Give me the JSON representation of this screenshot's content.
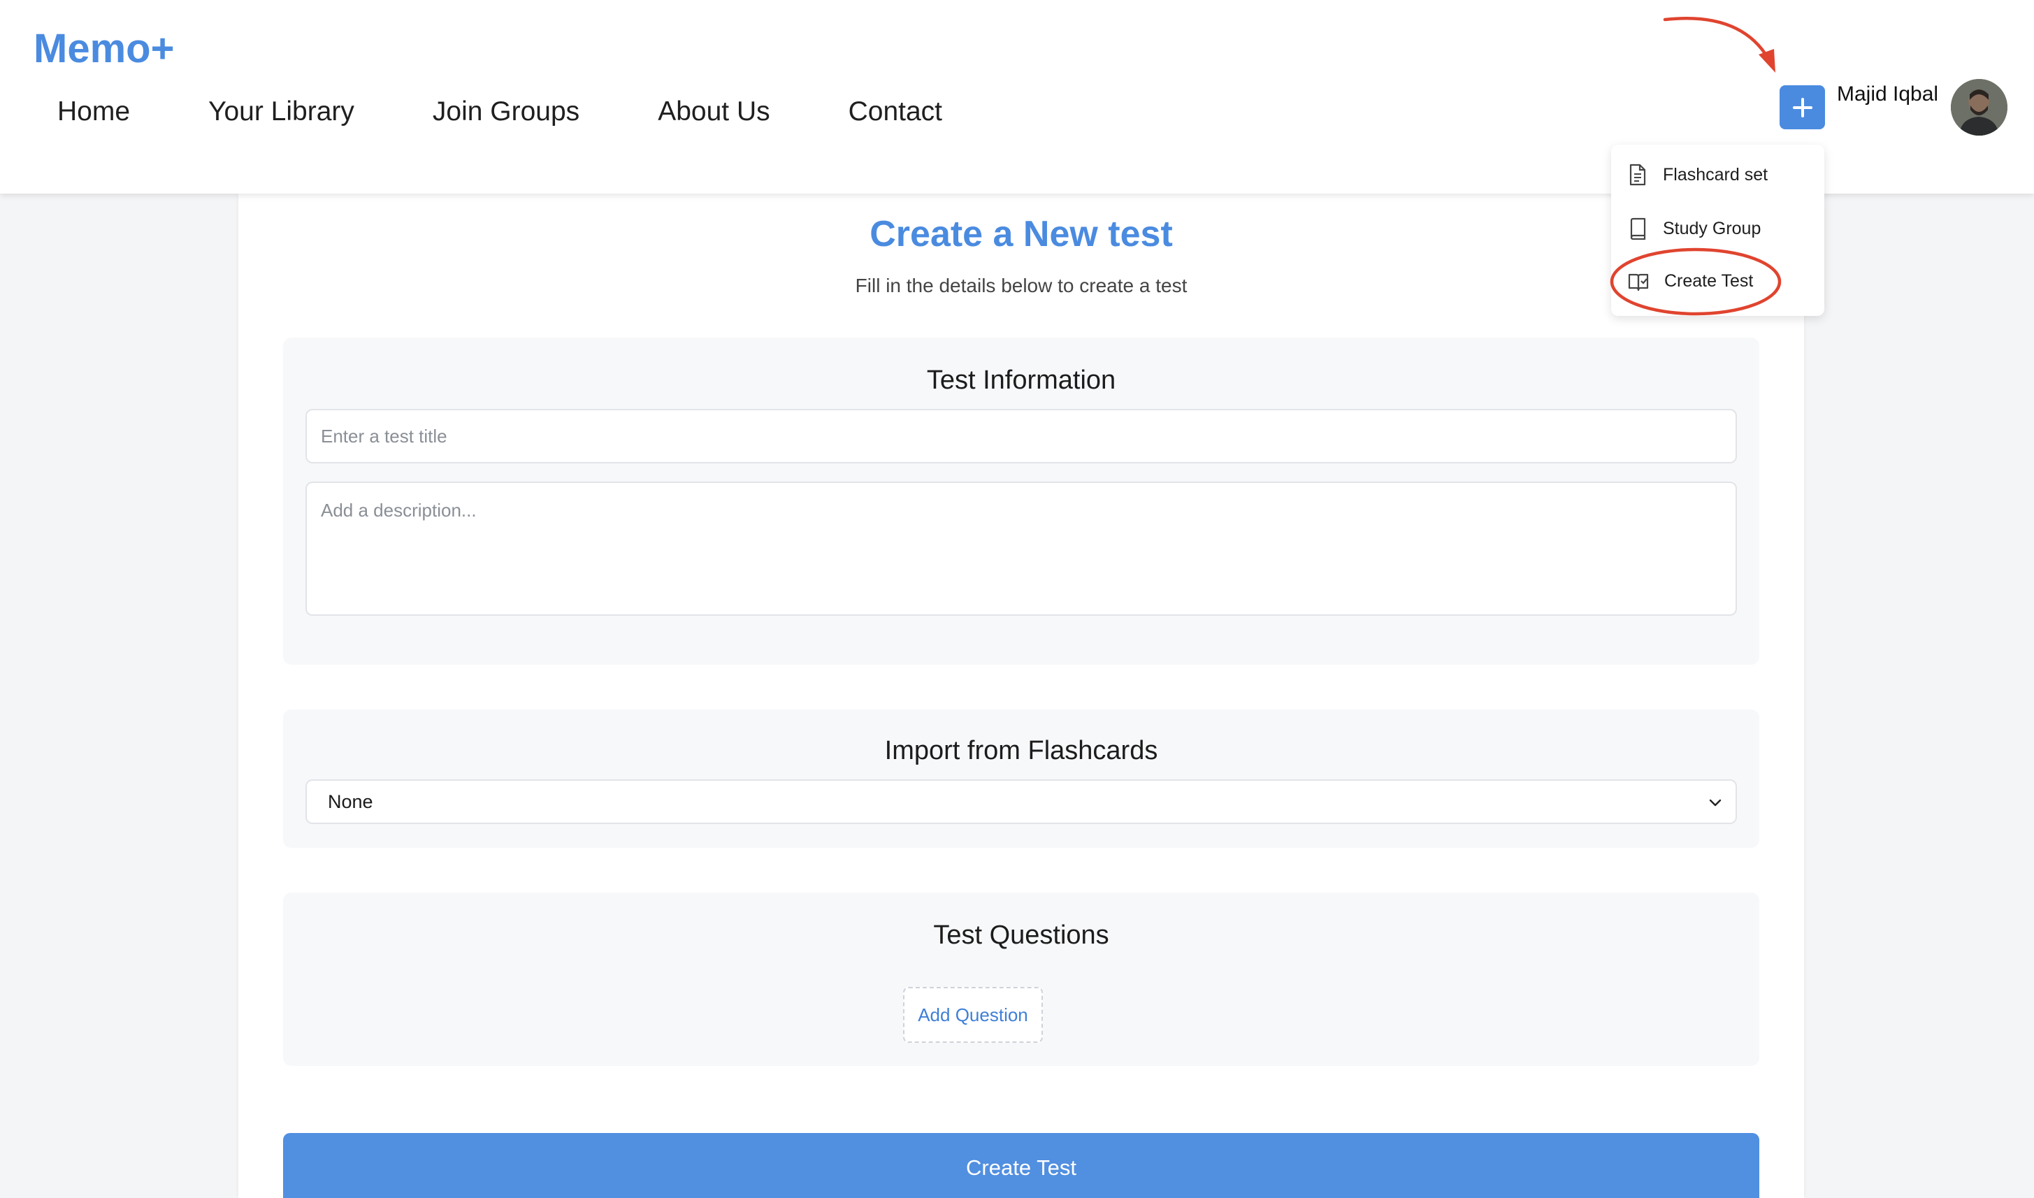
{
  "header": {
    "logo": "Memo+",
    "nav": [
      "Home",
      "Your Library",
      "Join Groups",
      "About Us",
      "Contact"
    ],
    "user_name": "Majid Iqbal"
  },
  "dropdown": {
    "items": [
      {
        "label": "Flashcard set",
        "icon": "document-icon"
      },
      {
        "label": "Study Group",
        "icon": "book-icon"
      },
      {
        "label": "Create Test",
        "icon": "test-icon"
      }
    ]
  },
  "main": {
    "title": "Create a New test",
    "subtitle": "Fill in the details below to create a test",
    "test_info": {
      "heading": "Test Information",
      "title_placeholder": "Enter a test title",
      "description_placeholder": "Add a description..."
    },
    "import": {
      "heading": "Import from Flashcards",
      "selected": "None"
    },
    "questions": {
      "heading": "Test Questions",
      "add_label": "Add Question"
    },
    "submit_label": "Create Test"
  },
  "colors": {
    "accent": "#4a8be0",
    "annotation": "#e0442f"
  }
}
